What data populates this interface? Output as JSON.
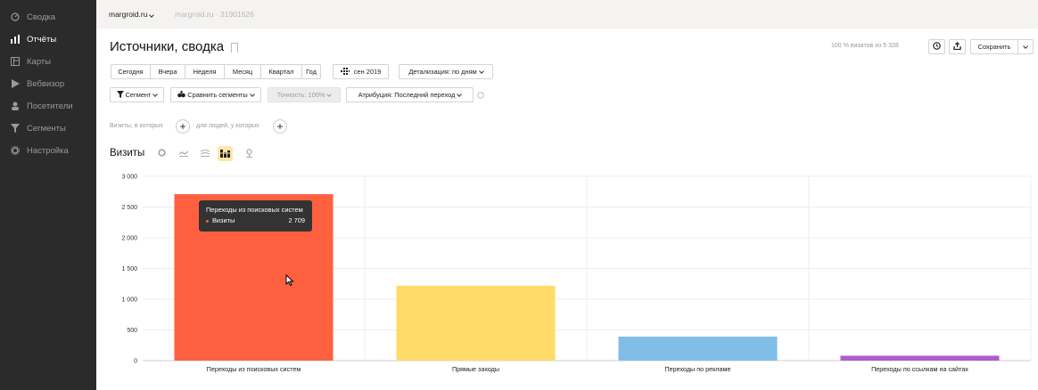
{
  "sidebar": {
    "items": [
      {
        "label": "Сводка",
        "icon": "dashboard-icon",
        "active": false
      },
      {
        "label": "Отчёты",
        "icon": "bar-chart-icon",
        "active": true
      },
      {
        "label": "Карты",
        "icon": "map-icon",
        "active": false
      },
      {
        "label": "Вебвизор",
        "icon": "play-icon",
        "active": false
      },
      {
        "label": "Посетители",
        "icon": "user-icon",
        "active": false
      },
      {
        "label": "Сегменты",
        "icon": "filter-icon",
        "active": false
      },
      {
        "label": "Настройка",
        "icon": "gear-icon",
        "active": false
      }
    ]
  },
  "topbar": {
    "site": "margroid.ru",
    "counter": "margroid.ru · 31901626"
  },
  "header": {
    "title": "Источники, сводка",
    "visits_info": "100 % визитов из 5 328",
    "save_label": "Сохранить"
  },
  "periods": [
    "Сегодня",
    "Вчера",
    "Неделя",
    "Месяц",
    "Квартал",
    "Год"
  ],
  "date_range": "сен 2019",
  "detail": "Детализация: по дням",
  "filters": {
    "segment": "Сегмент",
    "compare": "Сравнить сегменты",
    "accuracy": "Точность: 100%",
    "attribution": "Атрибуция: Последний переход"
  },
  "conditions": {
    "visits": "Визиты, в которых",
    "people": "для людей, у которых"
  },
  "chart_title": "Визиты",
  "chart_data": {
    "type": "bar",
    "categories": [
      "Переходы из поисковых систем",
      "Прямые заходы",
      "Переходы по рекламе",
      "Переходы по ссылкам на сайтах"
    ],
    "values": [
      2709,
      1220,
      390,
      80
    ],
    "colors": [
      "#ff6040",
      "#ffdc6a",
      "#80bde7",
      "#ae5dcc"
    ],
    "ylim": [
      0,
      3000
    ],
    "yticks": [
      0,
      500,
      1000,
      1500,
      2000,
      2500,
      3000
    ],
    "ytick_labels": [
      "0",
      "500",
      "1 000",
      "1 500",
      "2 000",
      "2 500",
      "3 000"
    ],
    "grid": true
  },
  "tooltip": {
    "title": "Переходы из поисковых систем",
    "series": "Визиты",
    "value": "2 709"
  }
}
